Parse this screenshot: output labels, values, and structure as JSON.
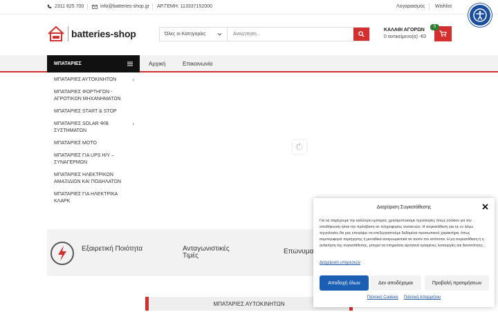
{
  "topbar": {
    "phone": "2311 825 700",
    "email": "info@batteries-shop.gr",
    "gemi": "ΑΡ.ΓΕΜΗ: 113337152000",
    "account": "Λογαριασμός",
    "wishlist": "Wishlist"
  },
  "logo": {
    "text": "batteries-shop"
  },
  "search": {
    "category": "Όλες οι Κατηγορίες",
    "placeholder": "Αναζήτηση..."
  },
  "cart": {
    "title": "ΚΑΛΑΘΙ ΑΓΟΡΩΝ",
    "subtitle": "0 αντικείμενο(α) -€0",
    "count": "0"
  },
  "nav": {
    "category_label": "ΜΠΑΤΑΡΙΕΣ",
    "links": [
      "Αρχική",
      "Επικοινωνία"
    ]
  },
  "sidemenu": {
    "items": [
      {
        "label": "ΜΠΑΤΑΡΙΕΣ ΑΥΤΟΚΙΝΗΤΩΝ",
        "arrow": "›"
      },
      {
        "label": "ΜΠΑΤΑΡΙΕΣ ΦΟΡΤΗΓΩΝ - ΑΓΡΟΤΙΚΩΝ ΜΗΧΑΝΗΜΑΤΩΝ",
        "arrow": ""
      },
      {
        "label": "ΜΠΑΤΑΡΙΕΣ START & STOP",
        "arrow": ""
      },
      {
        "label": "ΜΠΑΤΑΡΙΕΣ SOLAR Φ/Β ΣΥΣΤΗΜΑΤΩΝ",
        "arrow": "›"
      },
      {
        "label": "ΜΠΑΤΑΡΙΕΣ ΜΟΤΟ",
        "arrow": ""
      },
      {
        "label": "ΜΠΑΤΑΡΙΕΣ ΓΙΑ UPS Η/Υ – ΣΥΝΑΓΕΡΜΩΝ",
        "arrow": ""
      },
      {
        "label": "ΜΠΑΤΑΡΙΕΣ ΗΛΕΚΤΡΙΚΩΝ ΑΜΑΞΙΔΙΩΝ ΚΑΙ ΠΟΔΗΛΑΤΩΝ",
        "arrow": ""
      },
      {
        "label": "ΜΠΑΤΑΡΙΕΣ ΓΙΑ ΗΛΕΚΤΡΙΚΑ ΚΛΑΡΚ",
        "arrow": ""
      }
    ]
  },
  "features": {
    "f1": "Εξαιρετική Ποιότητα",
    "f2": "Ανταγωνιστικές Τιμές",
    "f3": "Επώνυμα"
  },
  "bottom_tab": "ΜΠΑΤΑΡΙΕΣ ΑΥΤΟΚΙΝΗΤΩΝ",
  "consent": {
    "title": "Διαχείριση Συγκατάθεσης",
    "body": "Για να παρέχουμε την καλύτερη εμπειρία, χρησιμοποιούμε τεχνολογίες όπως cookies για την αποθήκευση ή/και την πρόσβαση σε πληροφορίες συσκευών. Η συγκατάθεση για τις εν λόγω τεχνολογίες θα μας επιτρέψει να επεξεργαστούμε δεδομένα προσωπικού χαρακτήρα, όπως συμπεριφορά περιήγησης ή μοναδικά αναγνωριστικά σε αυτόν τον ιστότοπο. Η μη συγκατάθεση ή η ανάκληση της συγκατάθεσης, μπορεί να επηρεάσει αρνητικά ορισμένες λειτουργίες και δυνατότητες.",
    "manage": "Διαχείριση υπηρεσιών",
    "accept": "Αποδοχή όλων",
    "deny": "Δεν αποδέχομαι",
    "prefs": "Προβολή προτιμήσεων",
    "cookie_policy": "Πολιτική Cookies",
    "privacy_policy": "Πολιτική Απορρήτου"
  },
  "colors": {
    "accent": "#d32f2f",
    "dark": "#111111",
    "blue": "#1a5fb4",
    "badge": "#2e7d32"
  }
}
